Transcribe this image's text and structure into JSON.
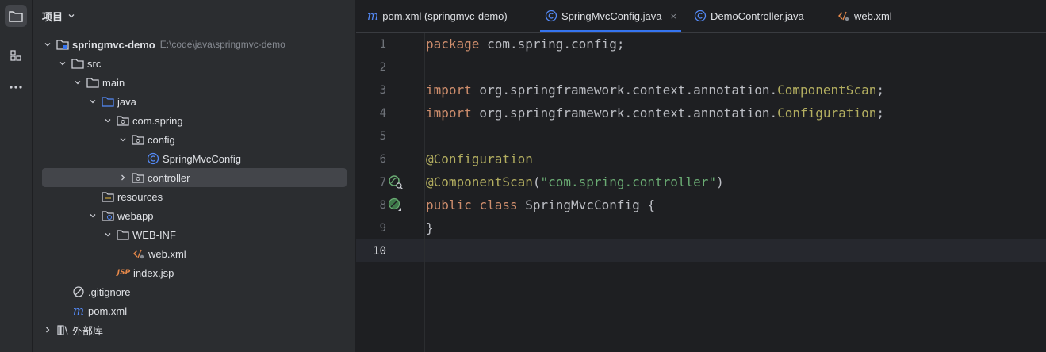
{
  "toolstrip": {
    "items": [
      {
        "icon": "folder-icon",
        "active": true
      },
      {
        "icon": "structure-icon",
        "active": false
      },
      {
        "icon": "more-icon",
        "active": false
      }
    ]
  },
  "project_panel": {
    "title": "项目",
    "tree": [
      {
        "label": "springmvc-demo",
        "hint": "E:\\code\\java\\springmvc-demo",
        "icon": "module-folder-icon",
        "expanded": true
      },
      {
        "label": "src",
        "icon": "folder-icon",
        "expanded": true
      },
      {
        "label": "main",
        "icon": "folder-icon",
        "expanded": true
      },
      {
        "label": "java",
        "icon": "source-folder-icon",
        "expanded": true
      },
      {
        "label": "com.spring",
        "icon": "package-icon",
        "expanded": true
      },
      {
        "label": "config",
        "icon": "package-icon",
        "expanded": true
      },
      {
        "label": "SpringMvcConfig",
        "icon": "java-class-icon"
      },
      {
        "label": "controller",
        "icon": "package-icon",
        "expanded": false,
        "selected": true
      },
      {
        "label": "resources",
        "icon": "resources-folder-icon"
      },
      {
        "label": "webapp",
        "icon": "web-folder-icon",
        "expanded": true
      },
      {
        "label": "WEB-INF",
        "icon": "folder-icon",
        "expanded": true
      },
      {
        "label": "web.xml",
        "icon": "xml-file-icon"
      },
      {
        "label": "index.jsp",
        "icon": "jsp-file-icon"
      },
      {
        "label": ".gitignore",
        "icon": "ignore-file-icon"
      },
      {
        "label": "pom.xml",
        "icon": "maven-file-icon"
      },
      {
        "label": "外部库",
        "icon": "library-icon",
        "expanded": false
      }
    ]
  },
  "editor": {
    "tabs": [
      {
        "label": "pom.xml (springmvc-demo)",
        "icon": "maven-file-icon",
        "active": false
      },
      {
        "label": "SpringMvcConfig.java",
        "icon": "java-class-icon",
        "active": true,
        "close": "×"
      },
      {
        "label": "DemoController.java",
        "icon": "java-class-icon",
        "active": false
      },
      {
        "label": "web.xml",
        "icon": "xml-file-icon",
        "active": false
      }
    ],
    "line_numbers": [
      "1",
      "2",
      "3",
      "4",
      "5",
      "6",
      "7",
      "8",
      "9",
      "10"
    ],
    "current_line": "10",
    "code": {
      "l1_kw": "package",
      "l1_rest": " com.spring.config;",
      "l3_kw": "import",
      "l3_rest": " org.springframework.context.annotation.",
      "l3_cls": "ComponentScan",
      "l3_end": ";",
      "l4_kw": "import",
      "l4_rest": " org.springframework.context.annotation.",
      "l4_cls": "Configuration",
      "l4_end": ";",
      "l6_ann": "@Configuration",
      "l7_ann": "@ComponentScan",
      "l7_open": "(",
      "l7_str": "\"com.spring.controller\"",
      "l7_close": ")",
      "l8_kw1": "public",
      "l8_kw2": "class",
      "l8_rest": " SpringMvcConfig {",
      "l9": "}"
    },
    "gutter_icons": [
      {
        "line": "7",
        "icon": "bean-scan-icon"
      },
      {
        "line": "8",
        "icon": "spring-bean-icon"
      }
    ]
  },
  "colors": {
    "keyword": "#cf8e6d",
    "annotation": "#b3ae60",
    "string": "#6aab73",
    "accent": "#3574f0"
  }
}
